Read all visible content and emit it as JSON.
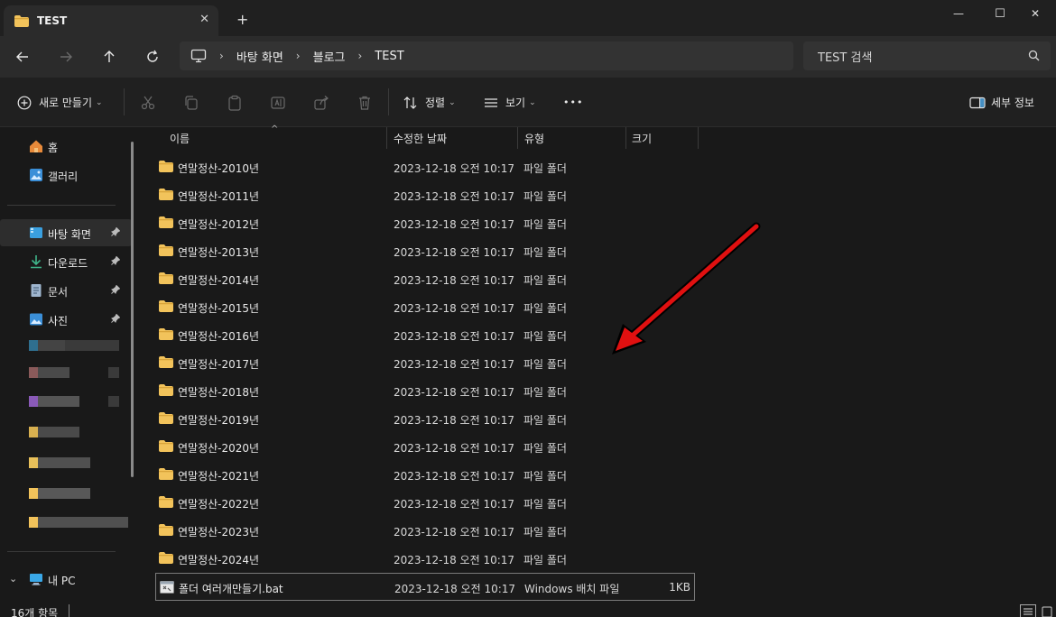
{
  "window": {
    "tab_title": "TEST",
    "tab_close": "✕",
    "new_tab": "+",
    "minimize": "—",
    "maximize": "☐",
    "close": "✕"
  },
  "address": {
    "crumbs": [
      "바탕 화면",
      "블로그",
      "TEST"
    ],
    "separator": "›"
  },
  "search": {
    "placeholder": "TEST 검색"
  },
  "toolbar": {
    "new_label": "새로 만들기",
    "sort_label": "정렬",
    "view_label": "보기",
    "more_label": "•••",
    "details_label": "세부 정보",
    "chevron": "⌄"
  },
  "sidebar": {
    "home": "홈",
    "gallery": "갤러리",
    "desktop": "바탕 화면",
    "downloads": "다운로드",
    "documents": "문서",
    "pictures": "사진",
    "this_pc": "내 PC",
    "expand_chevron": "⌄"
  },
  "columns": {
    "name": "이름",
    "modified": "수정한 날짜",
    "type": "유형",
    "size": "크기",
    "sort_indicator": "^"
  },
  "files": [
    {
      "name": "연말정산-2010년",
      "date": "2023-12-18 오전 10:17",
      "type": "파일 폴더",
      "size": ""
    },
    {
      "name": "연말정산-2011년",
      "date": "2023-12-18 오전 10:17",
      "type": "파일 폴더",
      "size": ""
    },
    {
      "name": "연말정산-2012년",
      "date": "2023-12-18 오전 10:17",
      "type": "파일 폴더",
      "size": ""
    },
    {
      "name": "연말정산-2013년",
      "date": "2023-12-18 오전 10:17",
      "type": "파일 폴더",
      "size": ""
    },
    {
      "name": "연말정산-2014년",
      "date": "2023-12-18 오전 10:17",
      "type": "파일 폴더",
      "size": ""
    },
    {
      "name": "연말정산-2015년",
      "date": "2023-12-18 오전 10:17",
      "type": "파일 폴더",
      "size": ""
    },
    {
      "name": "연말정산-2016년",
      "date": "2023-12-18 오전 10:17",
      "type": "파일 폴더",
      "size": ""
    },
    {
      "name": "연말정산-2017년",
      "date": "2023-12-18 오전 10:17",
      "type": "파일 폴더",
      "size": ""
    },
    {
      "name": "연말정산-2018년",
      "date": "2023-12-18 오전 10:17",
      "type": "파일 폴더",
      "size": ""
    },
    {
      "name": "연말정산-2019년",
      "date": "2023-12-18 오전 10:17",
      "type": "파일 폴더",
      "size": ""
    },
    {
      "name": "연말정산-2020년",
      "date": "2023-12-18 오전 10:17",
      "type": "파일 폴더",
      "size": ""
    },
    {
      "name": "연말정산-2021년",
      "date": "2023-12-18 오전 10:17",
      "type": "파일 폴더",
      "size": ""
    },
    {
      "name": "연말정산-2022년",
      "date": "2023-12-18 오전 10:17",
      "type": "파일 폴더",
      "size": ""
    },
    {
      "name": "연말정산-2023년",
      "date": "2023-12-18 오전 10:17",
      "type": "파일 폴더",
      "size": ""
    },
    {
      "name": "연말정산-2024년",
      "date": "2023-12-18 오전 10:17",
      "type": "파일 폴더",
      "size": ""
    },
    {
      "name": "폴더 여러개만들기.bat",
      "date": "2023-12-18 오전 10:17",
      "type": "Windows 배치 파일",
      "size": "1KB"
    }
  ],
  "status": {
    "item_count": "16개 항목"
  },
  "colors": {
    "folder": "#f2c35b",
    "folder_tab": "#d9a43a",
    "arrow": "#e01010",
    "accent": "#4ca3e0"
  }
}
